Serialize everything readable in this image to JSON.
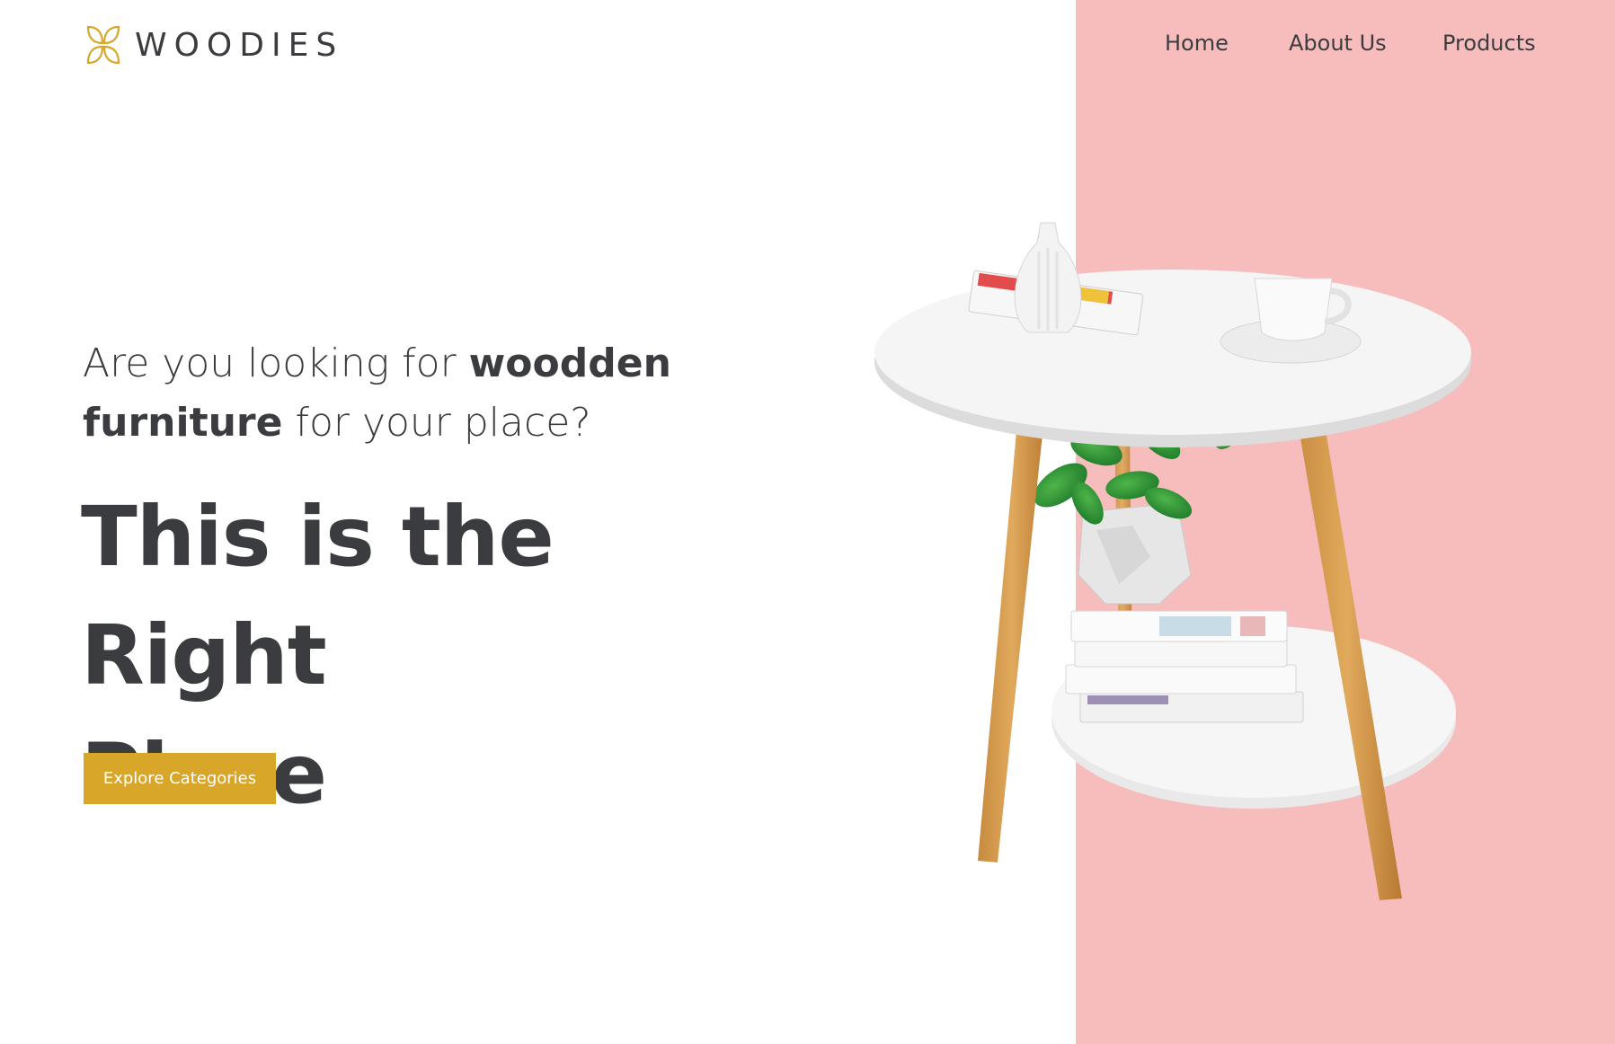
{
  "brand": {
    "name": "WOODIES",
    "logo_icon": "four-petal-leaf-icon",
    "accent": "#d8a72a"
  },
  "nav": {
    "items": [
      "Home",
      "About Us",
      "Products"
    ]
  },
  "hero": {
    "subhead_pre": "Are you looking for ",
    "subhead_bold_1": "woodden",
    "subhead_bold_2": "furniture",
    "subhead_post": " for your place?",
    "headline_line1": "This is the Right",
    "headline_line2": "Place",
    "cta_label": "Explore Categories",
    "image": "round-side-table-with-plant-and-books"
  },
  "colors": {
    "panel": "#f7bdbd",
    "text": "#3b3c40",
    "button": "#d8a72a"
  }
}
